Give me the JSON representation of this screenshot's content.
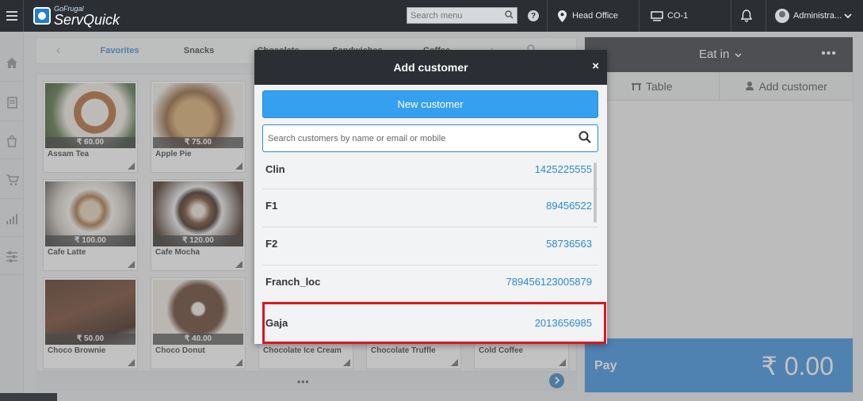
{
  "header": {
    "logo_small": "GoFrugal",
    "logo_big": "ServQuick",
    "search_placeholder": "Search menu",
    "location": "Head Office",
    "counter": "CO-1",
    "user": "Administra..."
  },
  "categories": {
    "tabs": [
      "Favorites",
      "Snacks",
      "Chocolate",
      "Sandwiches",
      "Coffee"
    ],
    "active": "Favorites"
  },
  "products": [
    {
      "name": "Assam Tea",
      "price": "₹ 60.00",
      "img": "tea"
    },
    {
      "name": "Apple Pie",
      "price": "₹ 75.00",
      "img": "pie"
    },
    {
      "name": "Cafe Latte",
      "price": "₹ 100.00",
      "img": "latte"
    },
    {
      "name": "Cafe Mocha",
      "price": "₹ 120.00",
      "img": "mocha"
    },
    {
      "name": "Choco Brownie",
      "price": "₹ 50.00",
      "img": "brownie"
    },
    {
      "name": "Choco Donut",
      "price": "₹ 40.00",
      "img": "donut"
    },
    {
      "name": "Chocolate Ice Cream",
      "price": "",
      "img": "blank"
    },
    {
      "name": "Chocolate Truffle",
      "price": "",
      "img": "blank"
    },
    {
      "name": "Cold Coffee",
      "price": "",
      "img": "blank"
    }
  ],
  "pager": {
    "dots": "•••"
  },
  "order_panel": {
    "mode": "Eat in",
    "more": "•••",
    "tab_table": "Table",
    "tab_add_customer": "Add customer",
    "pay_label": "Pay",
    "amount": "₹ 0.00"
  },
  "modal": {
    "title": "Add customer",
    "close": "×",
    "new_customer": "New customer",
    "search_placeholder": "Search customers by name or email or mobile",
    "customers": [
      {
        "name": "Clin",
        "phone": "1425225555"
      },
      {
        "name": "F1",
        "phone": "89456522"
      },
      {
        "name": "F2",
        "phone": "58736563"
      },
      {
        "name": "Franch_loc",
        "phone": "789456123005879"
      },
      {
        "name": "Gaja",
        "phone": "2013656985"
      }
    ]
  },
  "colors": {
    "accent": "#2b8ad6",
    "topbar": "#2b2f33",
    "highlight": "#e0141e",
    "pay": "#2f8ae0"
  }
}
